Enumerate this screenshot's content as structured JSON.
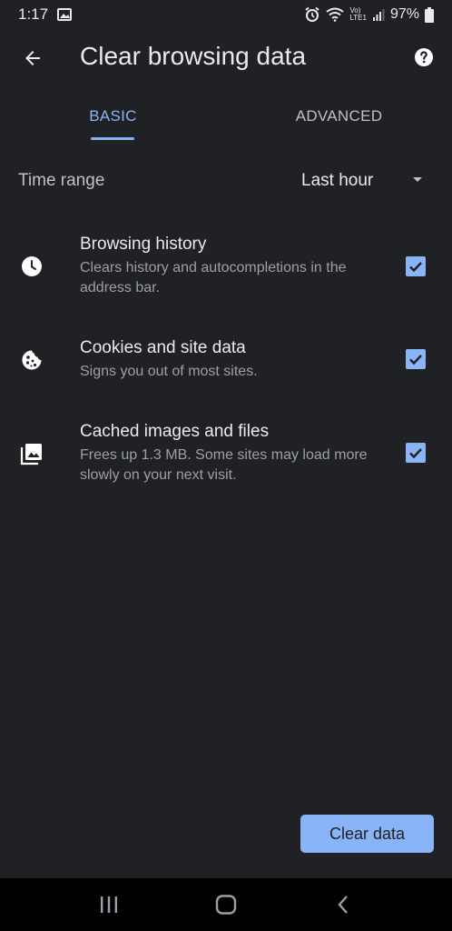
{
  "status_bar": {
    "time": "1:17",
    "network_label_top": "Vo)",
    "network_label_bottom": "LTE1",
    "battery": "97%"
  },
  "header": {
    "title": "Clear browsing data",
    "back_icon": "arrow-back-icon",
    "help_icon": "help-icon"
  },
  "tabs": [
    {
      "label": "BASIC",
      "selected": true
    },
    {
      "label": "ADVANCED",
      "selected": false
    }
  ],
  "time_range": {
    "label": "Time range",
    "value": "Last hour"
  },
  "options": [
    {
      "title": "Browsing history",
      "description": "Clears history and autocompletions in the address bar.",
      "icon": "clock-icon",
      "checked": true
    },
    {
      "title": "Cookies and site data",
      "description": "Signs you out of most sites.",
      "icon": "cookie-icon",
      "checked": true
    },
    {
      "title": "Cached images and files",
      "description": "Frees up 1.3 MB. Some sites may load more slowly on your next visit.",
      "icon": "images-icon",
      "checked": true
    }
  ],
  "actions": {
    "clear_label": "Clear data"
  },
  "colors": {
    "background": "#202124",
    "accent": "#8ab4f8",
    "text_primary": "#e8eaed",
    "text_secondary": "#9aa0a6",
    "nav_bar": "#000000"
  }
}
